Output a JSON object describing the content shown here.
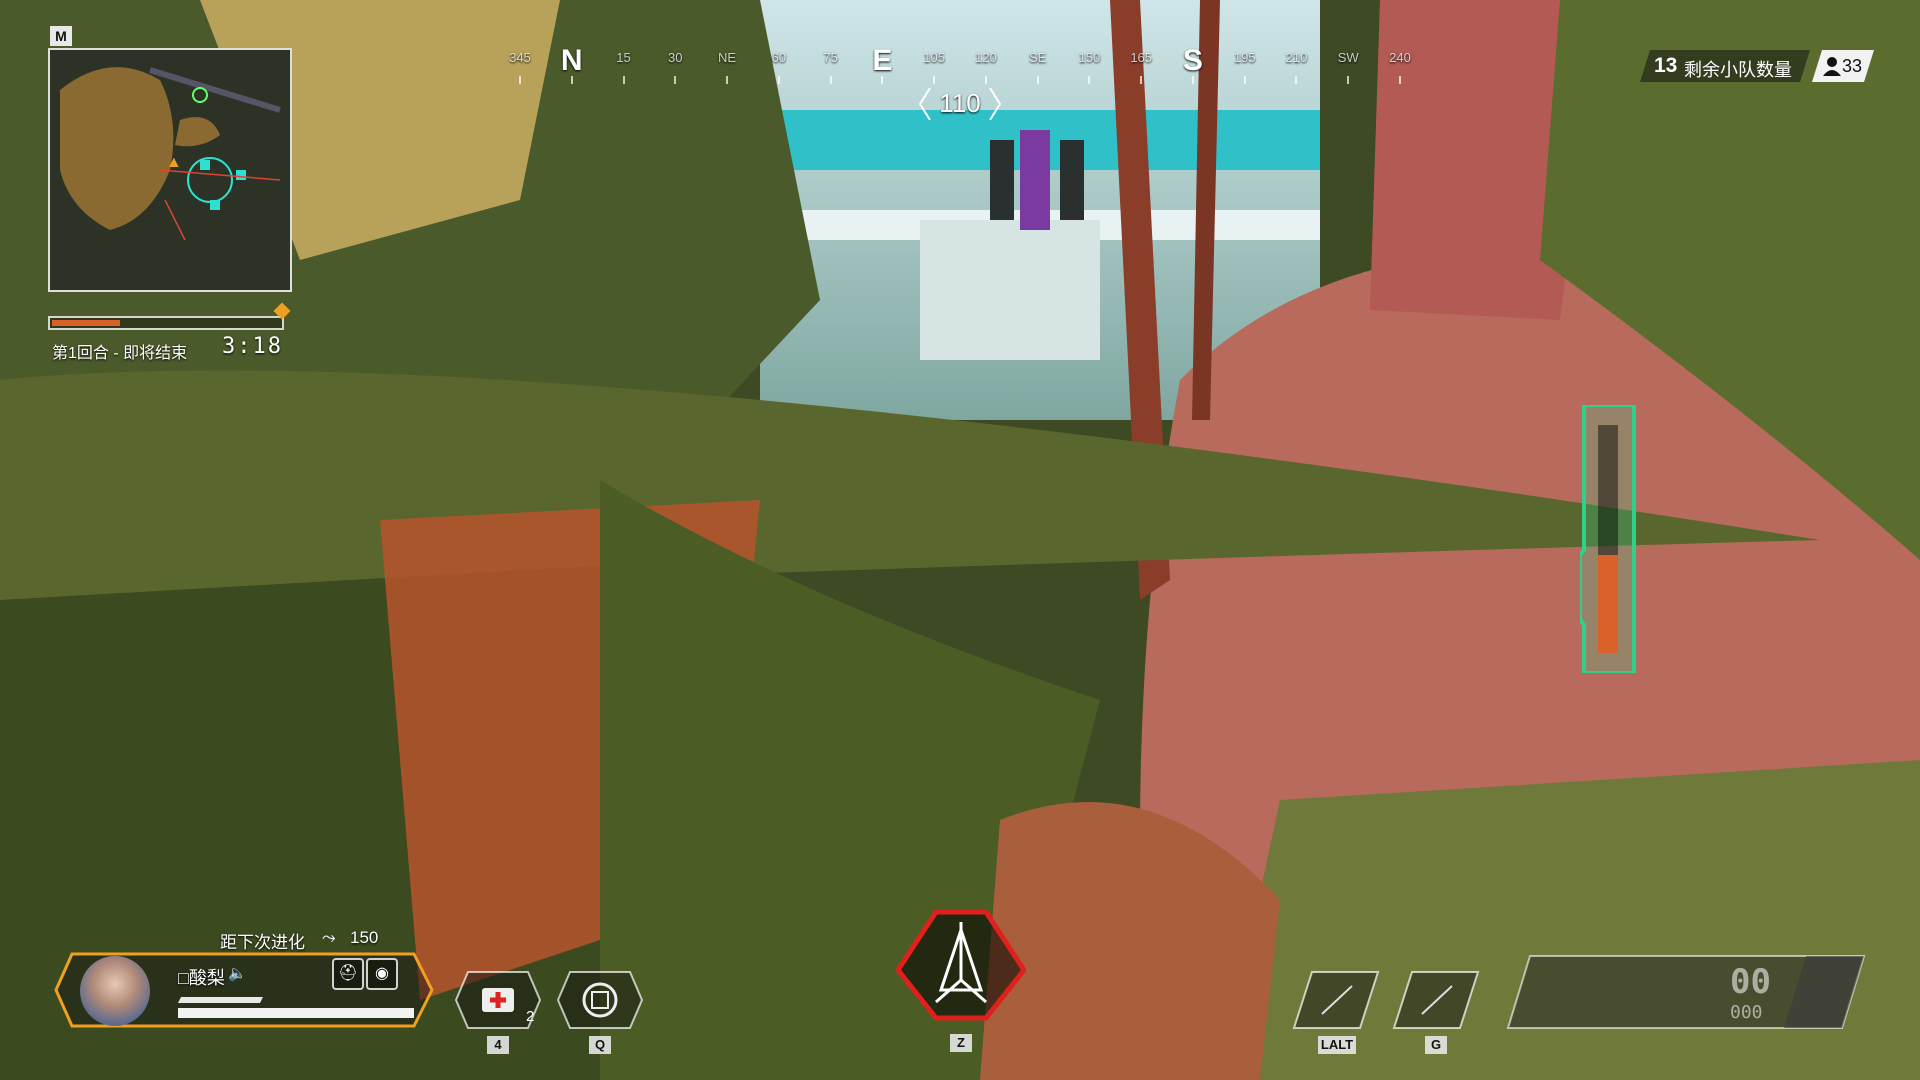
{
  "minimap": {
    "key": "M"
  },
  "round": {
    "label": "第1回合 - 即将结束",
    "timer": "3:18",
    "ring_progress": 0.3
  },
  "compass": {
    "ticks": [
      "345",
      "N",
      "15",
      "30",
      "NE",
      "60",
      "75",
      "E",
      "105",
      "120",
      "SE",
      "150",
      "165",
      "S",
      "195",
      "210",
      "SW",
      "240"
    ],
    "heading": "110"
  },
  "squads": {
    "count": "13",
    "label": "剩余小队数量",
    "players": "33",
    "players_icon": "person-icon"
  },
  "evo": {
    "label": "距下次进化",
    "value": "150",
    "icon": "evo-arrows-icon"
  },
  "player": {
    "name": "□酸梨",
    "voice_icon": "speaker-icon",
    "shield": 0.36,
    "health": 1.0,
    "perks": [
      "helmet-icon",
      "armor-icon"
    ]
  },
  "abilities": [
    {
      "key": "4",
      "icon": "medkit-icon",
      "count": "2"
    },
    {
      "key": "Q",
      "icon": "tactical-icon",
      "count": ""
    },
    {
      "key": "Z",
      "icon": "ultimate-icon",
      "count": ""
    },
    {
      "key": "LALT",
      "icon": "empty-slot-icon",
      "count": ""
    },
    {
      "key": "G",
      "icon": "empty-slot-icon",
      "count": ""
    }
  ],
  "weapon": {
    "ammo_mag": "00",
    "ammo_reserve": "000"
  },
  "colors": {
    "accent_orange": "#d8622a",
    "ult_red": "#e0201c",
    "meter_green": "#2fd18a"
  }
}
